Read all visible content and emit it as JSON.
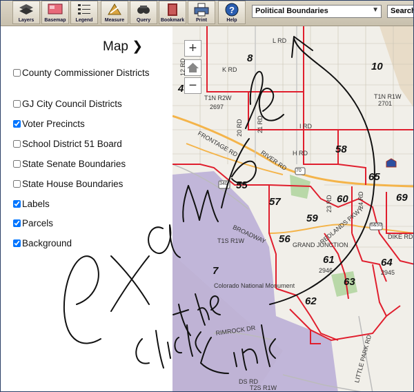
{
  "toolbar": {
    "buttons": [
      {
        "label": "Layers",
        "icon": "layers-icon"
      },
      {
        "label": "Basemap",
        "icon": "basemap-icon"
      },
      {
        "label": "Legend",
        "icon": "legend-icon"
      },
      {
        "label": "Measure",
        "icon": "measure-icon"
      },
      {
        "label": "Query",
        "icon": "query-icon"
      },
      {
        "label": "Bookmark",
        "icon": "bookmark-icon"
      },
      {
        "label": "Print",
        "icon": "print-icon"
      },
      {
        "label": "Help",
        "icon": "help-icon"
      }
    ],
    "layer_select": "Political Boundaries",
    "search_label": "Search"
  },
  "sidebar": {
    "title": "Map ❯",
    "layers": [
      {
        "label": "County Commissioner Districts",
        "checked": false
      },
      {
        "label": "GJ City Council Districts",
        "checked": false
      },
      {
        "label": "Voter Precincts",
        "checked": true
      },
      {
        "label": "School District 51 Board",
        "checked": false
      },
      {
        "label": "State Senate Boundaries",
        "checked": false
      },
      {
        "label": "State House Boundaries",
        "checked": false
      },
      {
        "label": "Labels",
        "checked": true
      },
      {
        "label": "Parcels",
        "checked": true
      },
      {
        "label": "Background",
        "checked": true
      }
    ]
  },
  "map": {
    "zoom_in": "+",
    "zoom_out": "−",
    "precinct_labels": [
      "8",
      "10",
      "4",
      "58",
      "55",
      "57",
      "60",
      "65",
      "69",
      "59",
      "56",
      "61",
      "64",
      "63",
      "62",
      "7"
    ],
    "road_labels": [
      "L RD",
      "K RD",
      "12 RD",
      "T1N R2W",
      "2697",
      "T1N R1W",
      "2701",
      "FRONTAGE RD",
      "20 RD",
      "21 RD",
      "I RD",
      "H RD",
      "RIVER RD",
      "T1S R1W",
      "GRAND JUNCTION",
      "Colorado National Monument",
      "DIKE RD",
      "2946",
      "2945",
      "RIMROCK DR",
      "DS RD",
      "LITTLE PARK RD",
      "T2S R1W",
      "BROADWAY",
      "REDLANDS PKWY",
      "23 RD",
      "24 RD",
      "6&50",
      "340",
      "70"
    ]
  },
  "colors": {
    "precinct_boundary": "#e01e2d",
    "monument_fill": "#b8acd6",
    "road": "#f4b44a",
    "ink": "#111111"
  },
  "annotation": {
    "handwriting": [
      "example",
      "click the Link"
    ]
  }
}
